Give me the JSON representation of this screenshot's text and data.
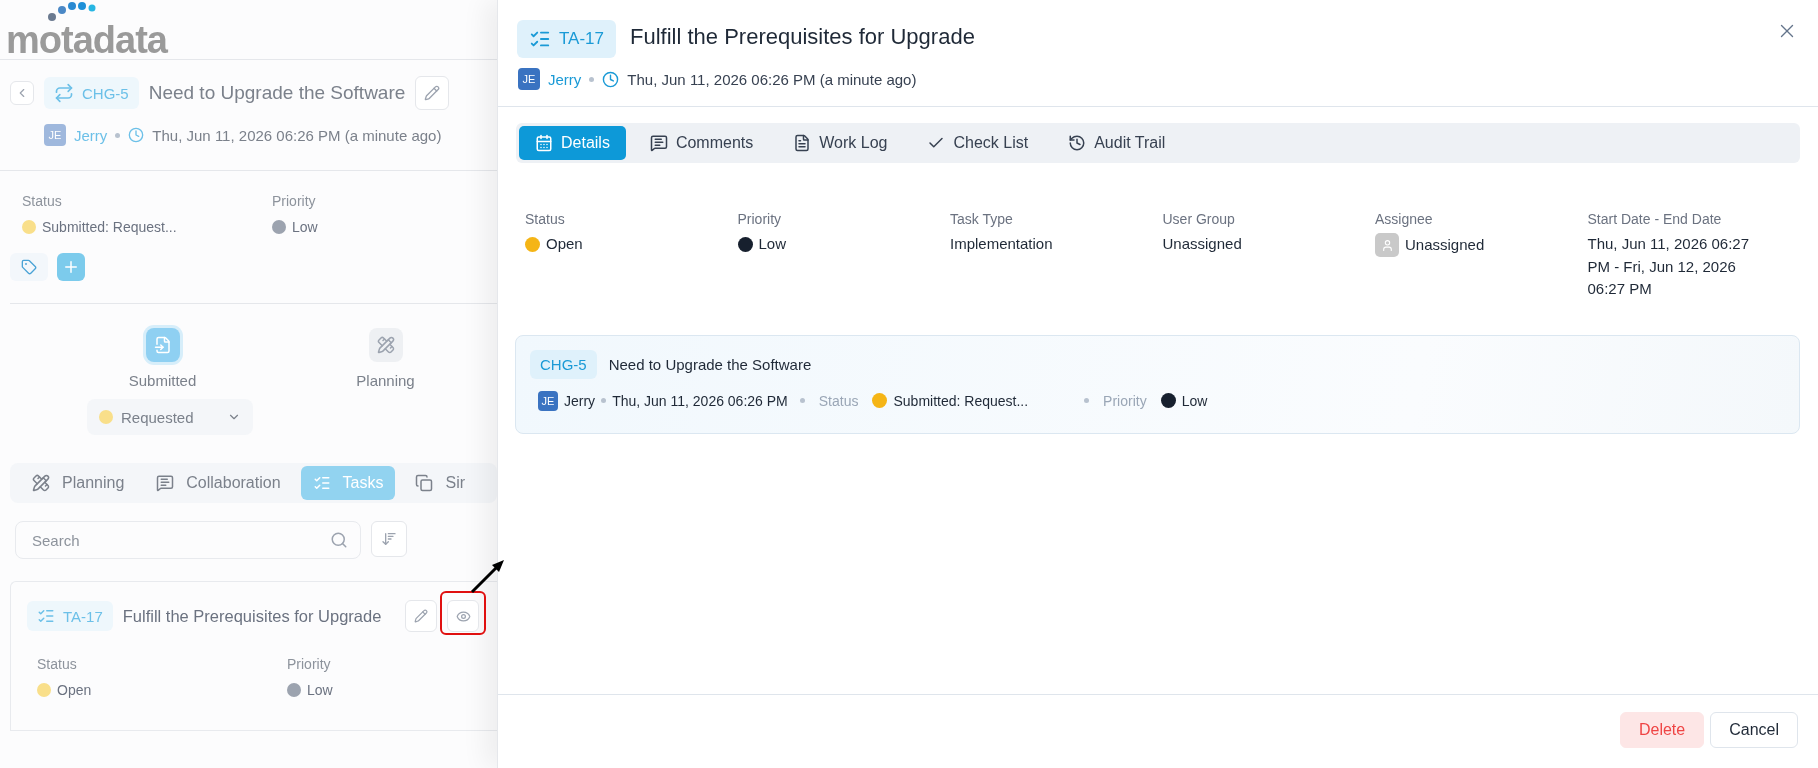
{
  "logo": {
    "text": "motadata"
  },
  "request": {
    "id": "CHG-5",
    "title": "Need to Upgrade the Software",
    "initials": "JE",
    "author": "Jerry",
    "time": "Thu, Jun 11, 2026 06:26 PM (a minute ago)",
    "fields": [
      {
        "label": "Status",
        "value": "Submitted: Request...",
        "color": "#f9df8a"
      },
      {
        "label": "Priority",
        "value": "Low",
        "color": "#9ca3af"
      }
    ]
  },
  "stepper": [
    {
      "label": "Submitted",
      "selected": true
    },
    {
      "label": "Planning",
      "selected": false
    }
  ],
  "stage": {
    "value": "Requested",
    "color": "#f9df8a"
  },
  "tabs": [
    {
      "label": "Planning",
      "selected": false
    },
    {
      "label": "Collaboration",
      "selected": false
    },
    {
      "label": "Tasks",
      "selected": true
    },
    {
      "label": "Sir",
      "selected": false
    }
  ],
  "search": {
    "placeholder": "Search"
  },
  "task": {
    "id": "TA-17",
    "title": "Fulfill the Prerequisites for Upgrade",
    "fields": [
      {
        "label": "Status",
        "value": "Open",
        "color": "#f9df8a"
      },
      {
        "label": "Priority",
        "value": "Low",
        "color": "#9ca3af"
      }
    ]
  },
  "drawer": {
    "id": "TA-17",
    "title": "Fulfill the Prerequisites for Upgrade",
    "initials": "JE",
    "author": "Jerry",
    "time": "Thu, Jun 11, 2026 06:26 PM (a minute ago)",
    "tabs": [
      {
        "label": "Details",
        "selected": true
      },
      {
        "label": "Comments",
        "selected": false
      },
      {
        "label": "Work Log",
        "selected": false
      },
      {
        "label": "Check List",
        "selected": false
      },
      {
        "label": "Audit Trail",
        "selected": false
      }
    ],
    "fields": [
      {
        "label": "Status",
        "kind": "dot",
        "value": "Open",
        "color": "#f5b516"
      },
      {
        "label": "Priority",
        "kind": "dot",
        "value": "Low",
        "color": "#17202e"
      },
      {
        "label": "Task Type",
        "kind": "text",
        "value": "Implementation"
      },
      {
        "label": "User Group",
        "kind": "text",
        "value": "Unassigned"
      },
      {
        "label": "Assignee",
        "kind": "avatar",
        "value": "Unassigned"
      },
      {
        "label": "Start Date - End Date",
        "kind": "text",
        "value": "Thu, Jun 11, 2026 06:27 PM - Fri, Jun 12, 2026 06:27 PM"
      }
    ],
    "related": {
      "id": "CHG-5",
      "title": "Need to Upgrade the Software",
      "initials": "JE",
      "author": "Jerry",
      "time": "Thu, Jun 11, 2026 06:26 PM",
      "fields": [
        {
          "label": "Status",
          "value": "Submitted: Request...",
          "color": "#f5b516"
        },
        {
          "label": "Priority",
          "value": "Low",
          "color": "#17202e"
        }
      ]
    },
    "buttons": [
      {
        "label": "Delete",
        "kind": "danger"
      },
      {
        "label": "Cancel",
        "kind": "plain"
      }
    ]
  }
}
